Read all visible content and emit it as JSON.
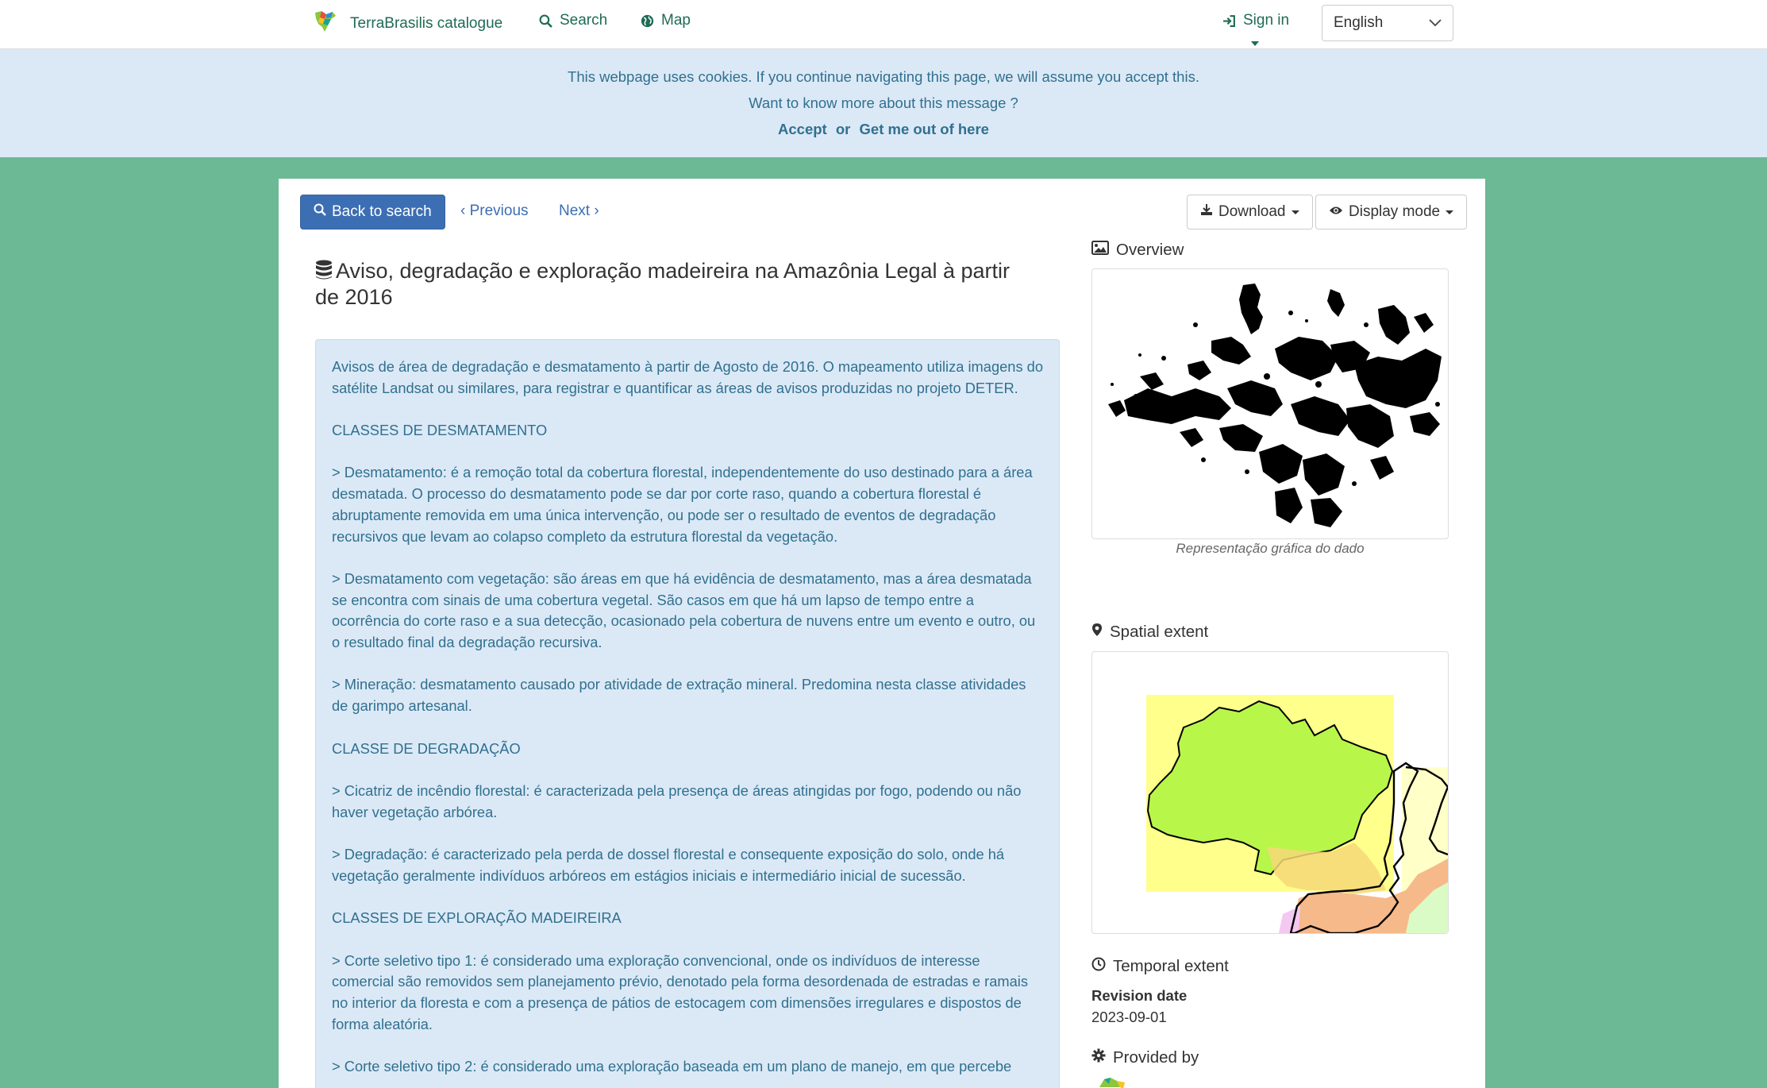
{
  "navbar": {
    "brand": "TerraBrasilis catalogue",
    "search": "Search",
    "map": "Map",
    "sign_in": "Sign in",
    "language": "English"
  },
  "cookie": {
    "message": "This webpage uses cookies. If you continue navigating this page, we will assume you accept this.",
    "more": "Want to know more about this message ?",
    "accept": "Accept",
    "or": "or",
    "leave": "Get me out of here"
  },
  "toolbar": {
    "back": "Back to search",
    "previous": "Previous",
    "next": "Next",
    "download": "Download",
    "display_mode": "Display mode"
  },
  "record": {
    "title": "Aviso, degradação e exploração madeireira na Amazônia Legal à partir de 2016",
    "paragraphs": [
      "Avisos de área de degradação e desmatamento à partir de Agosto de 2016. O mapeamento utiliza imagens do satélite Landsat ou similares, para registrar e quantificar as áreas de avisos produzidas no projeto DETER.",
      "CLASSES DE DESMATAMENTO",
      "> Desmatamento: é a remoção total da cobertura florestal, independentemente do uso destinado para a área desmatada. O processo do desmatamento pode se dar por corte raso, quando a cobertura florestal é abruptamente removida em uma única intervenção, ou pode ser o resultado de eventos de degradação recursivos que levam ao colapso completo da estrutura florestal da vegetação.",
      "> Desmatamento com vegetação: são áreas em que há evidência de desmatamento, mas a área desmatada se encontra com sinais de uma cobertura vegetal. São casos em que há um lapso de tempo entre a ocorrência do corte raso e a sua detecção, ocasionado pela cobertura de nuvens entre um evento e outro, ou o resultado final da degradação recursiva.",
      "> Mineração: desmatamento causado por atividade de extração mineral. Predomina nesta classe atividades de garimpo artesanal.",
      "CLASSE DE DEGRADAÇÃO",
      "> Cicatriz de incêndio florestal: é caracterizada pela presença de áreas atingidas por fogo, podendo ou não haver vegetação arbórea.",
      "> Degradação: é caracterizado pela perda de dossel florestal e consequente exposição do solo, onde há vegetação geralmente indivíduos arbóreos em estágios iniciais e intermediário inicial de sucessão.",
      "CLASSES DE EXPLORAÇÃO MADEIREIRA",
      "> Corte seletivo tipo 1: é considerado uma exploração convencional, onde os indivíduos de interesse comercial são removidos sem planejamento prévio, denotado pela forma desordenada de estradas e ramais no interior da floresta e com a presença de pátios de estocagem com dimensões irregulares e dispostos de forma aleatória.",
      "> Corte seletivo tipo 2: é considerado uma exploração baseada em um plano de manejo, em que percebe"
    ]
  },
  "sidebar": {
    "overview_heading": "Overview",
    "overview_caption": "Representação gráfica do dado",
    "spatial_heading": "Spatial extent",
    "temporal_heading": "Temporal extent",
    "revision_label": "Revision date",
    "revision_value": "2023-09-01",
    "provided_heading": "Provided by"
  },
  "colors": {
    "page_bg": "#6cb995",
    "link": "#1f6b55",
    "primary": "#3c6eb4",
    "info_bg": "#dbe9f6",
    "info_text": "#31708f"
  }
}
